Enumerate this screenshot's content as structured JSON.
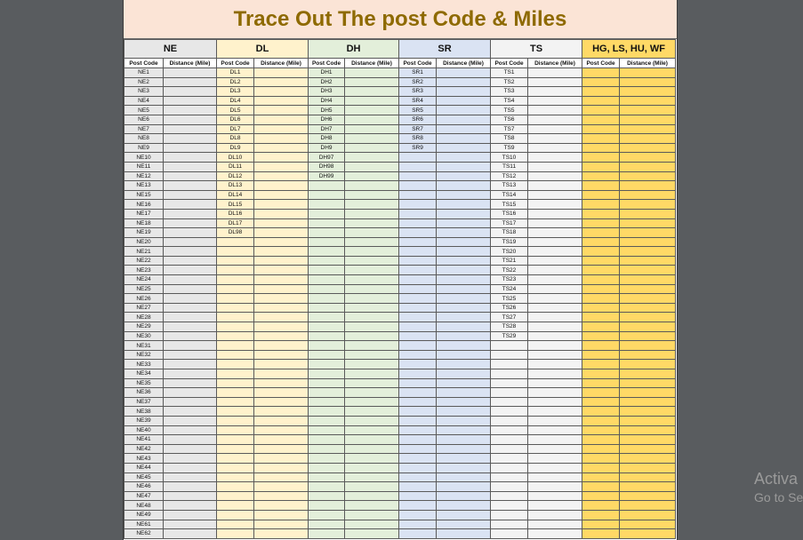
{
  "title": "Trace Out The post Code & Miles",
  "groups": [
    "NE",
    "DL",
    "DH",
    "SR",
    "TS",
    "HG, LS, HU, WF"
  ],
  "subheaders": {
    "post_code": "Post Code",
    "distance": "Distance (Mile)"
  },
  "columns": {
    "ne": [
      "NE1",
      "NE2",
      "NE3",
      "NE4",
      "NE5",
      "NE6",
      "NE7",
      "NE8",
      "NE9",
      "NE10",
      "NE11",
      "NE12",
      "NE13",
      "NE15",
      "NE16",
      "NE17",
      "NE18",
      "NE19",
      "NE20",
      "NE21",
      "NE22",
      "NE23",
      "NE24",
      "NE25",
      "NE26",
      "NE27",
      "NE28",
      "NE29",
      "NE30",
      "NE31",
      "NE32",
      "NE33",
      "NE34",
      "NE35",
      "NE36",
      "NE37",
      "NE38",
      "NE39",
      "NE40",
      "NE41",
      "NE42",
      "NE43",
      "NE44",
      "NE45",
      "NE46",
      "NE47",
      "NE48",
      "NE49",
      "NE61",
      "NE62"
    ],
    "dl": [
      "DL1",
      "DL2",
      "DL3",
      "DL4",
      "DL5",
      "DL6",
      "DL7",
      "DL8",
      "DL9",
      "DL10",
      "DL11",
      "DL12",
      "DL13",
      "DL14",
      "DL15",
      "DL16",
      "DL17",
      "DL98"
    ],
    "dh": [
      "DH1",
      "DH2",
      "DH3",
      "DH4",
      "DH5",
      "DH6",
      "DH7",
      "DH8",
      "DH9",
      "DH97",
      "DH98",
      "DH99"
    ],
    "sr": [
      "SR1",
      "SR2",
      "SR3",
      "SR4",
      "SR5",
      "SR6",
      "SR7",
      "SR8",
      "SR9"
    ],
    "ts": [
      "TS1",
      "TS2",
      "TS3",
      "TS4",
      "TS5",
      "TS6",
      "TS7",
      "TS8",
      "TS9",
      "TS10",
      "TS11",
      "TS12",
      "TS13",
      "TS14",
      "TS15",
      "TS16",
      "TS17",
      "TS18",
      "TS19",
      "TS20",
      "TS21",
      "TS22",
      "TS23",
      "TS24",
      "TS25",
      "TS26",
      "TS27",
      "TS28",
      "TS29"
    ],
    "hg": []
  },
  "watermark": {
    "line1": "Activa",
    "line2": "Go to Se"
  },
  "colors": {
    "title_bg": "#fbe4d6",
    "title_text": "#8e6a00",
    "ne_bg": "#e7e7e7",
    "dl_bg": "#fff2cc",
    "dh_bg": "#e3efda",
    "sr_bg": "#dae3f3",
    "ts_bg": "#f3f3f3",
    "hg_bg": "#ffd966"
  }
}
